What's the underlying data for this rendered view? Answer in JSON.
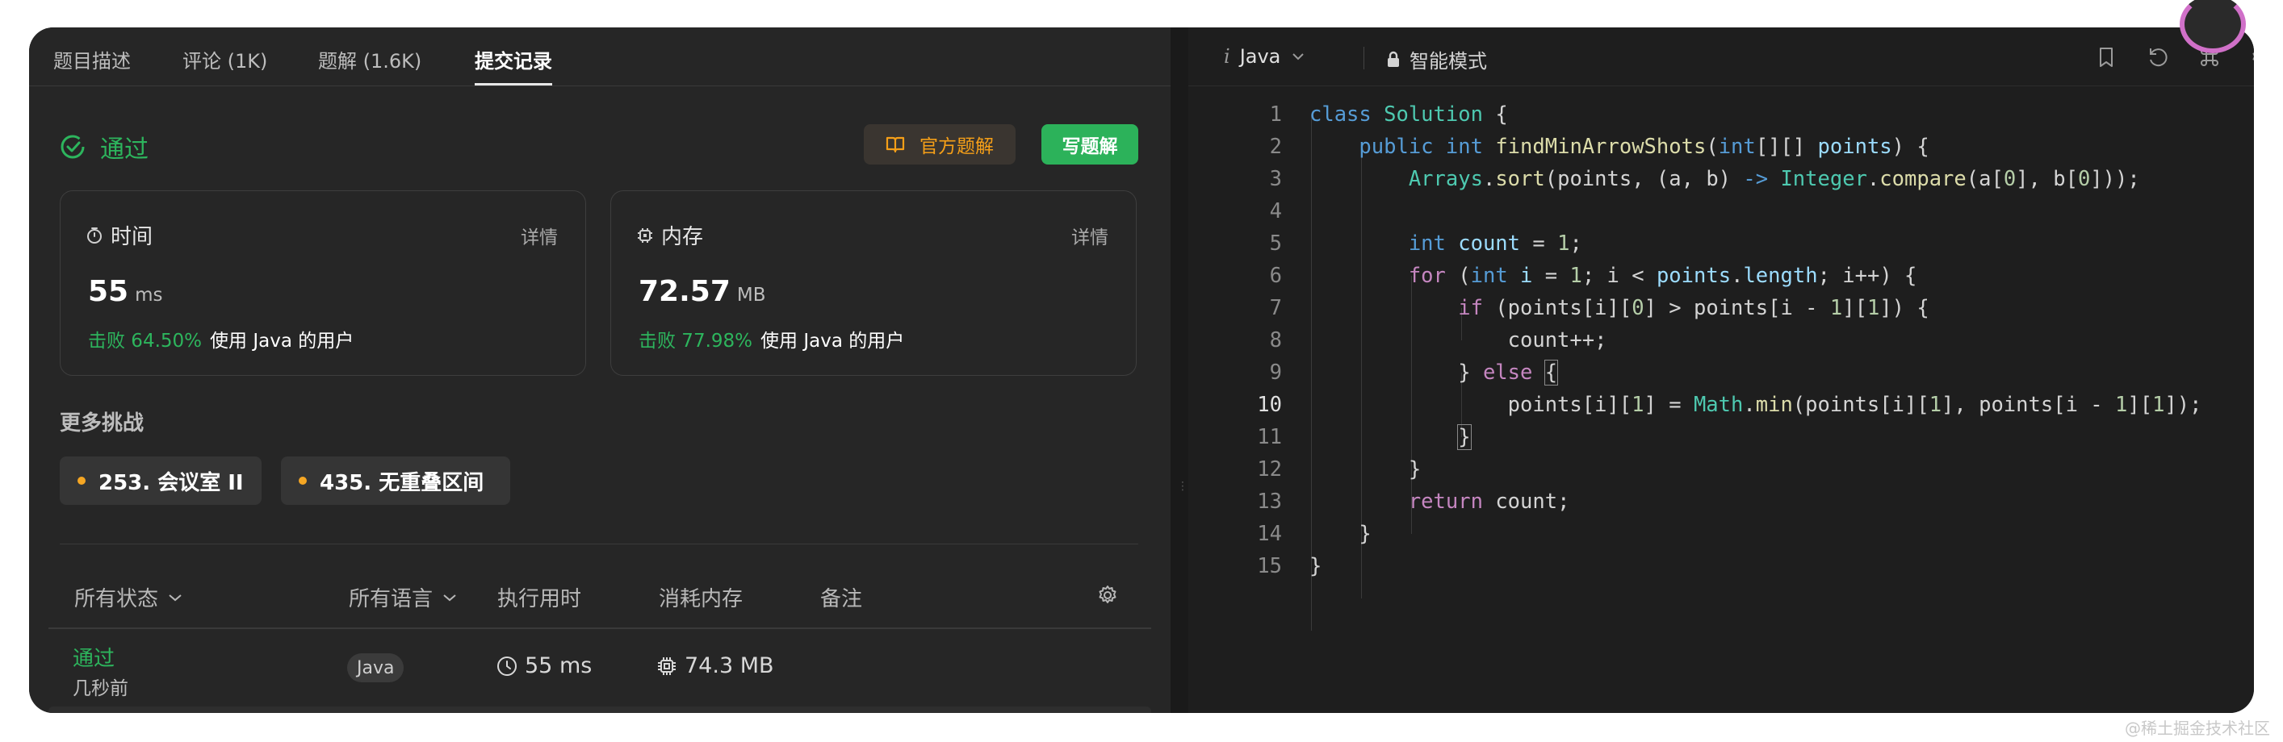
{
  "tabs": [
    "题目描述",
    "评论 (1K)",
    "题解 (1.6K)",
    "提交记录"
  ],
  "result": {
    "status": "通过"
  },
  "buttons": {
    "official": "官方题解",
    "write": "写题解"
  },
  "time_card": {
    "title": "时间",
    "detail": "详情",
    "value": "55",
    "unit": "ms",
    "beat": "击败 64.50%",
    "users": "使用 Java 的用户"
  },
  "mem_card": {
    "title": "内存",
    "detail": "详情",
    "value": "72.57",
    "unit": "MB",
    "beat": "击败 77.98%",
    "users": "使用 Java 的用户"
  },
  "more": {
    "title": "更多挑战",
    "items": [
      "253. 会议室 II",
      "435. 无重叠区间"
    ]
  },
  "table": {
    "headers": [
      "所有状态",
      "所有语言",
      "执行用时",
      "消耗内存",
      "备注"
    ],
    "row": {
      "status": "通过",
      "when": "几秒前",
      "lang": "Java",
      "runtime": "55 ms",
      "memory": "74.3 MB"
    }
  },
  "editor": {
    "language": "Java",
    "mode": "智能模式"
  },
  "code_line_numbers": [
    "1",
    "2",
    "3",
    "4",
    "5",
    "6",
    "7",
    "8",
    "9",
    "10",
    "11",
    "12",
    "13",
    "14",
    "15"
  ],
  "watermark": "@稀土掘金技术社区",
  "colors": {
    "accent_green": "#2db55d",
    "accent_orange": "#f59f18"
  }
}
